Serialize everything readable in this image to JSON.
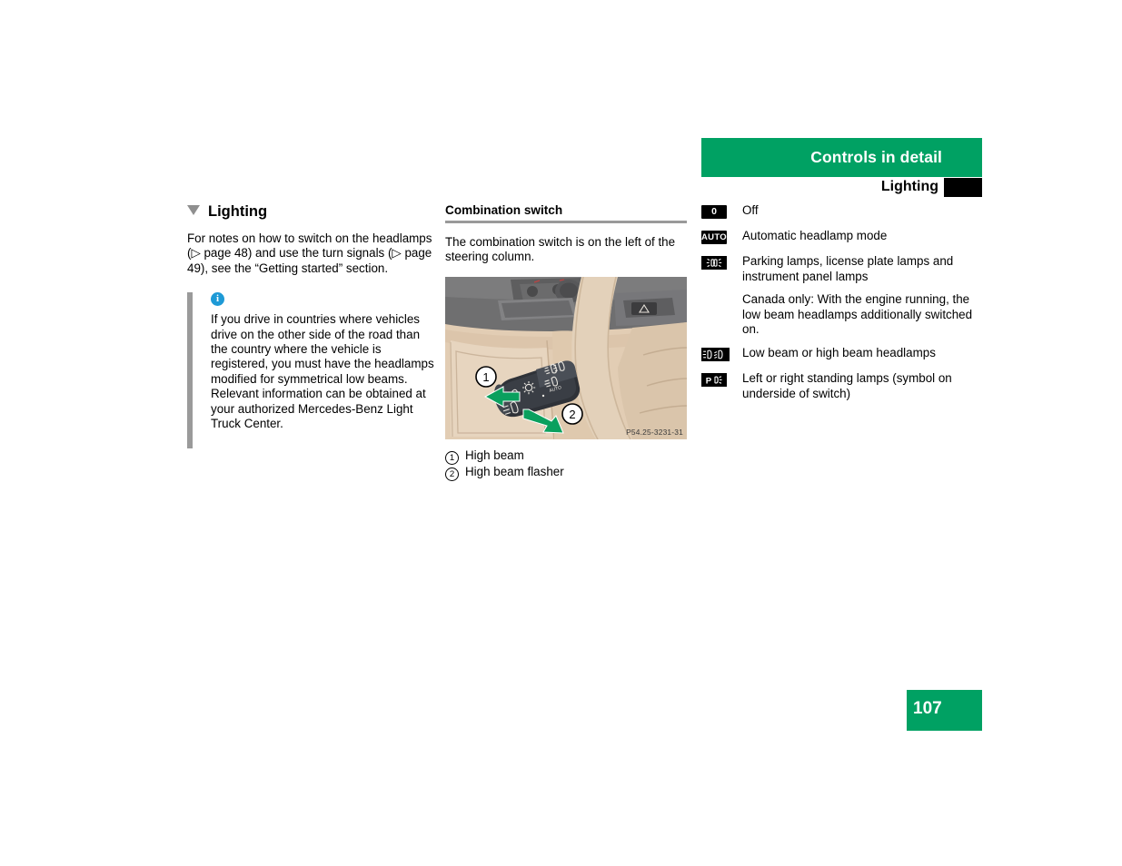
{
  "header": {
    "band_title": "Controls in detail",
    "sub_title": "Lighting",
    "band_color": "#00A163",
    "tab_color": "#000000"
  },
  "page_number": "107",
  "left_column": {
    "heading": "Lighting",
    "intro": "For notes on how to switch on the headlamps (▷ page 48) and use the turn signals (▷ page 49), see the “Getting started” section.",
    "note": {
      "icon": "info-icon",
      "icon_glyph": "i",
      "icon_color": "#1E9AD6",
      "text": "If you drive in countries where vehicles drive on the other side of the road than the country where the vehicle is registered, you must have the headlamps modified for symmetrical low beams. Relevant information can be obtained at your authorized Mercedes-Benz Light Truck Center."
    }
  },
  "middle_column": {
    "heading": "Combination switch",
    "body": "The combination switch is on the left of the steering column.",
    "figure": {
      "code": "P54.25-3231-31",
      "alt": "Combination switch stalk on left of steering column",
      "callout_1": "1",
      "callout_2": "2"
    },
    "legend": [
      {
        "num": "1",
        "label": "High beam"
      },
      {
        "num": "2",
        "label": "High beam flasher"
      }
    ]
  },
  "right_column": {
    "symbols": [
      {
        "icon": "zero-position-icon",
        "glyph": "0",
        "type": "text",
        "label": "Off"
      },
      {
        "icon": "auto-headlamp-icon",
        "glyph": "AUTO",
        "type": "text",
        "label": "Automatic headlamp mode"
      },
      {
        "icon": "parking-lamp-icon",
        "glyph": "",
        "type": "parking",
        "label": "Parking lamps, license plate lamps and instrument panel lamps"
      },
      {
        "icon": "",
        "glyph": "",
        "type": "none",
        "label": "Canada only: With the engine running, the low beam headlamps additionally switched on."
      },
      {
        "icon": "low-high-beam-icon",
        "glyph": "",
        "type": "beam",
        "label": "Low beam or high beam headlamps"
      },
      {
        "icon": "standing-lamp-icon",
        "glyph": "P",
        "type": "standing",
        "label": "Left or right standing lamps (symbol on underside of switch)"
      }
    ]
  },
  "footer": {
    "page_label": "107",
    "color": "#00A163"
  }
}
